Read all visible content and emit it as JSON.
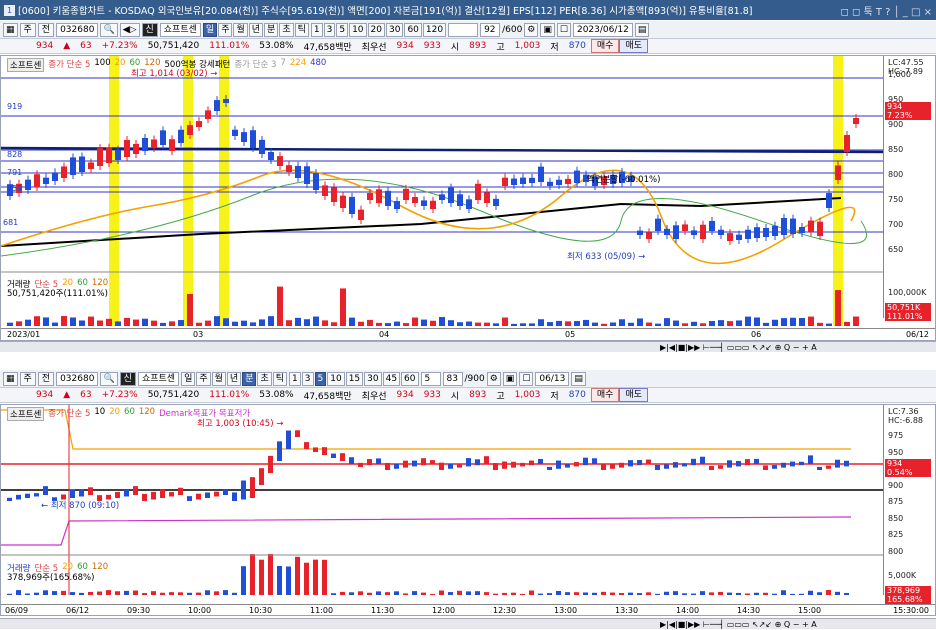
{
  "window": {
    "num": "1",
    "title": "[0600] 키움종합차트 - KOSDAQ 외국인보유[20.084(천)] 주식수[95.619(천)] 액면[200] 자본금[191(억)] 결산[12월] EPS[112] PER[8.36] 시가총액[893(억)] 유통비율[81.8]",
    "controls": "◻ ◻ 툭 T ? │ _ □ ×"
  },
  "top": {
    "toolbar": {
      "mode": "주",
      "prev": "전",
      "code": "032680",
      "q": "Q",
      "sound": "◀▷",
      "brand": "쇼프트센",
      "periods": [
        "일",
        "주",
        "월",
        "년",
        "분",
        "초",
        "틱"
      ],
      "active_period": "일",
      "nums": [
        "1",
        "3",
        "5",
        "10",
        "20",
        "30",
        "60",
        "120"
      ],
      "count": "92",
      "total": "/600",
      "date": "2023/06/12"
    },
    "quote": {
      "volume_fmt": "934",
      "arrow": "▲",
      "change": "63",
      "rate": "+7.23%",
      "vol": "50,751,420",
      "vol_ratio": "111.01%",
      "turn": "53.08%",
      "amount": "47,658백만",
      "best": "최우선",
      "ask": "934",
      "bid": "933",
      "open_lbl": "시",
      "open": "893",
      "high_lbl": "고",
      "high": "1,003",
      "low_lbl": "저",
      "low": "870",
      "buy": "매수",
      "sell": "매도"
    },
    "legend": {
      "brand": "소프트센",
      "ma": "종가 단순 5",
      "m10": "100",
      "m20": "20",
      "m60": "60",
      "m120": "120",
      "extra": "500억봉 강세패턴",
      "ma2": "종가 단순 3",
      "m7": "7",
      "m224": "224",
      "m480": "480"
    },
    "annotations": {
      "high": "최고 1,014 (03/02) →",
      "low": "최저 633 (05/09) →",
      "split": "액면분할(-60.01%)"
    },
    "hlines": [
      "919",
      "828",
      "791",
      "759",
      "681"
    ],
    "axis": {
      "lc": "LC:47.55",
      "hc": "HC:-7.89",
      "labels": [
        "1,000",
        "950",
        "900",
        "850",
        "800",
        "750",
        "700",
        "650"
      ],
      "price": "934",
      "pct": "7.23%"
    },
    "vol_legend": {
      "title": "거래량",
      "ma": "단순 5",
      "m20": "20",
      "m60": "60",
      "m120": "120",
      "value": "50,751,420주(111.01%)"
    },
    "vol_axis": {
      "label": "100,000K",
      "price": "50,751K",
      "pct": "111.01%"
    },
    "xaxis": [
      "2023/01",
      "03",
      "04",
      "05",
      "06"
    ],
    "xlast": "06/12"
  },
  "bottom": {
    "toolbar": {
      "mode": "주",
      "prev": "전",
      "code": "032680",
      "brand": "쇼프트센",
      "periods": [
        "일",
        "주",
        "월",
        "년",
        "분",
        "초",
        "틱"
      ],
      "active_period": "분",
      "nums": [
        "1",
        "3",
        "5",
        "10",
        "15",
        "30",
        "45",
        "60"
      ],
      "count": "5",
      "pos": "83",
      "total": "/900",
      "date": "06/13"
    },
    "quote": {
      "volume_fmt": "934",
      "arrow": "▲",
      "change": "63",
      "rate": "+7.23%",
      "vol": "50,751,420",
      "vol_ratio": "111.01%",
      "turn": "53.08%",
      "amount": "47,658백만",
      "best": "최우선",
      "ask": "934",
      "bid": "933",
      "open_lbl": "시",
      "open": "893",
      "high_lbl": "고",
      "high": "1,003",
      "low_lbl": "저",
      "low": "870",
      "buy": "매수",
      "sell": "매도"
    },
    "legend": {
      "brand": "소프트센",
      "ma": "종가 단순 5",
      "m10": "10",
      "m20": "20",
      "m60": "60",
      "m120": "120",
      "extra": "Demark목표가 목표저가"
    },
    "annotations": {
      "high": "최고 1,003 (10:45) →",
      "low": "← 최저 870 (09:10)"
    },
    "axis": {
      "lc": "LC:7.36",
      "hc": "HC:-6.88",
      "labels": [
        "975",
        "950",
        "925",
        "900",
        "875",
        "850",
        "825",
        "800"
      ],
      "price": "934",
      "pct": "0.54%"
    },
    "vol_legend": {
      "title": "거래량",
      "ma": "단순 5",
      "m20": "20",
      "m60": "60",
      "m120": "120",
      "value": "378,969주(165.68%)"
    },
    "vol_axis": {
      "label": "5,000K",
      "price": "378,969",
      "pct": "165.68%"
    },
    "xaxis": [
      "06/09",
      "06/12",
      "09:30",
      "10:00",
      "10:30",
      "11:00",
      "11:30",
      "12:00",
      "12:30",
      "13:00",
      "13:30",
      "14:00",
      "14:30",
      "15:00"
    ],
    "xlast": "15:30:00"
  },
  "colors": {
    "up": "#e8222a",
    "down": "#1f4fd8",
    "highlight": "#f7f21a",
    "title": "#345c8c"
  }
}
